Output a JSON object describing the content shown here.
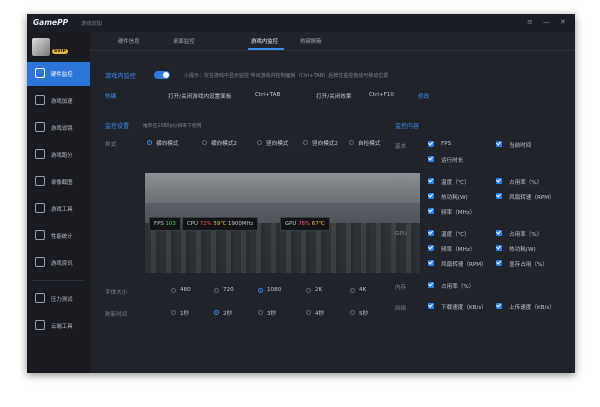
{
  "app": {
    "logo": "GamePP",
    "title": "游戏加加",
    "vip": "SVIP"
  },
  "window_controls": [
    "≡",
    "—",
    "✕"
  ],
  "sidebar": {
    "items": [
      {
        "label": "硬件监控",
        "active": true
      },
      {
        "label": "游戏加速"
      },
      {
        "label": "游戏滤镜"
      },
      {
        "label": "游戏跑分"
      },
      {
        "label": "录像截图"
      },
      {
        "label": "游戏工具"
      },
      {
        "label": "性能统计"
      },
      {
        "label": "游戏资讯"
      },
      {
        "label": "压力测试"
      },
      {
        "label": "云端工具"
      }
    ]
  },
  "tabs": [
    "硬件信息",
    "桌面监控",
    "游戏内监控",
    "热键屏蔽"
  ],
  "monitor": {
    "title": "游戏内监控",
    "tip": "小提示：仅在游戏中显示监控 呼出游戏内控制面板（Ctrl+TAB）后按住监控拖动可移动位置",
    "hotkey_label": "热键",
    "panel_label": "打开/关闭游戏内设置面板",
    "panel_key": "Ctrl+TAB",
    "effect_label": "打开/关闭效果",
    "effect_key": "Ctrl+F10",
    "modify": "修改"
  },
  "settings": {
    "title": "监控设置",
    "hint": "推荐在1080p分辨率下使用",
    "style_label": "样式",
    "styles": [
      "横向模式",
      "横向模式2",
      "竖向模式",
      "竖向模式2",
      "自检模式"
    ],
    "font_label": "字体大小",
    "fonts": [
      "480",
      "720",
      "1080",
      "2K",
      "4K"
    ],
    "refresh_label": "刷新时间",
    "refresh": [
      "1秒",
      "2秒",
      "3秒",
      "4秒",
      "5秒"
    ]
  },
  "osd": {
    "fps_label": "FPS",
    "fps": "103",
    "cpu_label": "CPU",
    "cpu_load": "72%",
    "cpu_temp": "59℃",
    "cpu_freq": "1900MHz",
    "gpu_label": "GPU",
    "gpu_load": "78%",
    "gpu_temp": "67℃"
  },
  "content": {
    "title": "监控内容",
    "basic_label": "基本",
    "basic": [
      "FPS",
      "当前时间",
      "运行时长"
    ],
    "cpu_label": "CPU",
    "cpu": [
      "温度（℃）",
      "占用率（%）",
      "热功耗(W)",
      "风扇转速（RPM）",
      "频率（MHz）"
    ],
    "gpu_label": "GPU",
    "gpu": [
      "温度（℃）",
      "占用率（%）",
      "频率（MHz）",
      "热功耗(W)",
      "风扇转速（RPM）",
      "显存占用（%）"
    ],
    "mem_label": "内存",
    "mem": [
      "占用率（%）"
    ],
    "net_label": "网络",
    "net": [
      "下载速度（KB/s）",
      "上传速度（KB/s）"
    ]
  }
}
